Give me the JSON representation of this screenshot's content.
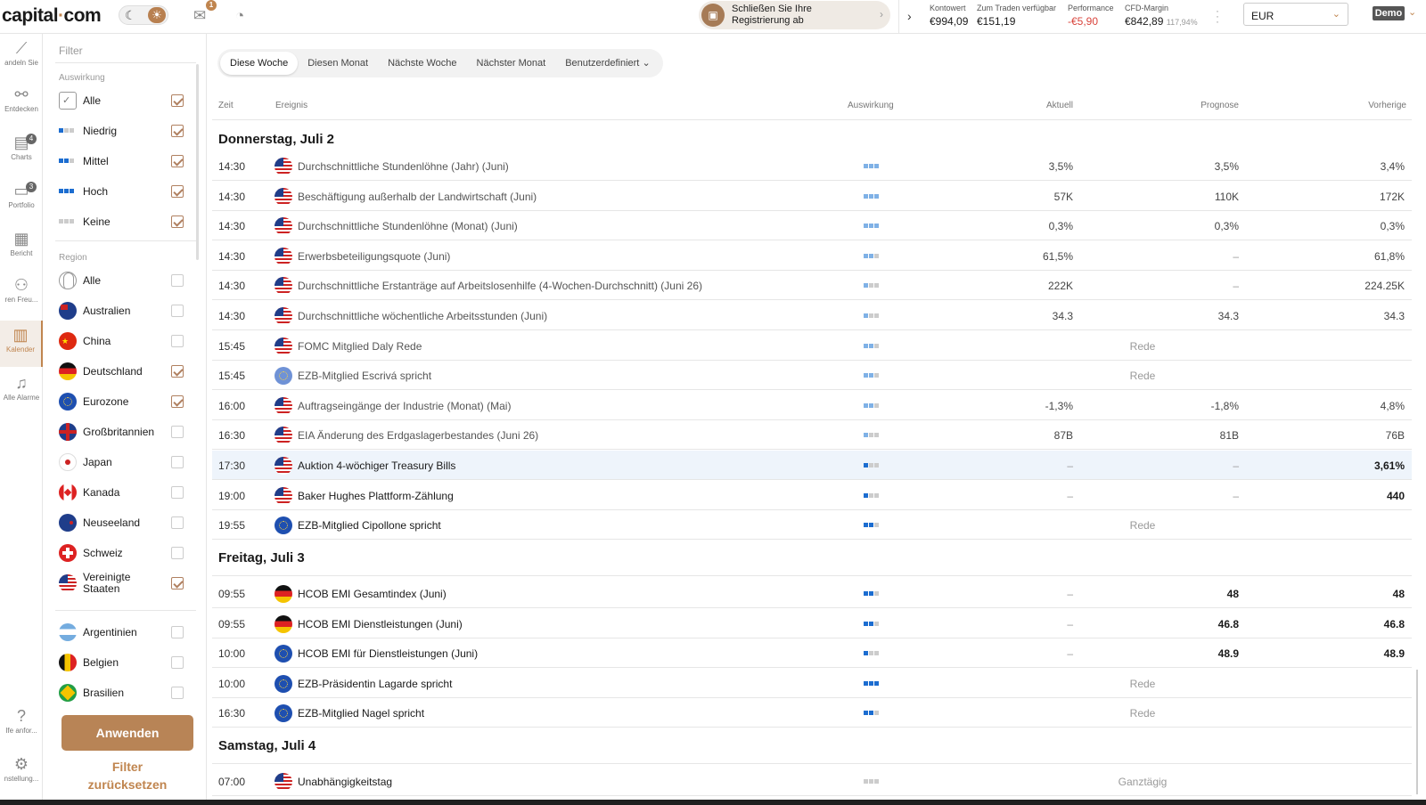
{
  "header": {
    "logo_text": "capital",
    "logo_dot": "·",
    "logo_suffix": "com",
    "mail_badge": "1",
    "promo_line1": "Schließen Sie Ihre",
    "promo_line2": "Registrierung ab",
    "stats": [
      {
        "label": "Kontowert",
        "value": "€994,09"
      },
      {
        "label": "Zum Traden verfügbar",
        "value": "€151,19"
      },
      {
        "label": "Performance",
        "value": "-€5,90"
      },
      {
        "label": "CFD-Margin",
        "value": "€842,89",
        "sub": "117,94%"
      }
    ],
    "currency": "EUR",
    "account_mode": "Demo"
  },
  "rail": [
    {
      "label": "andeln Sie",
      "icon": "chart-line-icon"
    },
    {
      "label": "Entdecken",
      "icon": "network-icon"
    },
    {
      "label": "Charts",
      "icon": "charts-icon",
      "badge": "4"
    },
    {
      "label": "Portfolio",
      "icon": "briefcase-icon",
      "badge": "3"
    },
    {
      "label": "Bericht",
      "icon": "report-icon"
    },
    {
      "label": "ren Freu...",
      "icon": "add-friend-icon"
    },
    {
      "label": "Kalender",
      "icon": "calendar-icon",
      "active": true
    },
    {
      "label": "Alle Alarme",
      "icon": "bell-icon"
    },
    {
      "label": "Ife anfor...",
      "icon": "help-icon"
    },
    {
      "label": "nstellung...",
      "icon": "gear-icon"
    }
  ],
  "filter": {
    "title": "Filter",
    "impact_title": "Auswirkung",
    "impact": [
      {
        "label": "Alle",
        "checked": true
      },
      {
        "label": "Niedrig",
        "checked": true
      },
      {
        "label": "Mittel",
        "checked": true
      },
      {
        "label": "Hoch",
        "checked": true
      },
      {
        "label": "Keine",
        "checked": true
      }
    ],
    "region_title": "Region",
    "regions": [
      {
        "label": "Alle",
        "checked": false,
        "flag": "globe"
      },
      {
        "label": "Australien",
        "checked": false,
        "flag": "au"
      },
      {
        "label": "China",
        "checked": false,
        "flag": "cn"
      },
      {
        "label": "Deutschland",
        "checked": true,
        "flag": "de"
      },
      {
        "label": "Eurozone",
        "checked": true,
        "flag": "eu"
      },
      {
        "label": "Großbritannien",
        "checked": false,
        "flag": "gb"
      },
      {
        "label": "Japan",
        "checked": false,
        "flag": "jp"
      },
      {
        "label": "Kanada",
        "checked": false,
        "flag": "ca"
      },
      {
        "label": "Neuseeland",
        "checked": false,
        "flag": "nz"
      },
      {
        "label": "Schweiz",
        "checked": false,
        "flag": "ch"
      },
      {
        "label": "Vereinigte Staaten",
        "checked": true,
        "flag": "us"
      },
      {
        "label": "Argentinien",
        "checked": false,
        "flag": "ar"
      },
      {
        "label": "Belgien",
        "checked": false,
        "flag": "be"
      },
      {
        "label": "Brasilien",
        "checked": false,
        "flag": "br"
      }
    ],
    "apply_label": "Anwenden",
    "reset_label": "Filter zurücksetzen"
  },
  "tabs": [
    {
      "label": "Diese Woche",
      "active": true
    },
    {
      "label": "Diesen Monat"
    },
    {
      "label": "Nächste Woche"
    },
    {
      "label": "Nächster Monat"
    },
    {
      "label": "Benutzerdefiniert"
    }
  ],
  "columns": {
    "time": "Zeit",
    "event": "Ereignis",
    "impact": "Auswirkung",
    "actual": "Aktuell",
    "forecast": "Prognose",
    "previous": "Vorherige"
  },
  "days": [
    {
      "title": "Donnerstag, Juli 2",
      "rows": [
        {
          "time": "14:30",
          "flag": "us",
          "event": "Durchschnittliche Stundenlöhne (Jahr) (Juni)",
          "impact": 3,
          "actual": "3,5%",
          "forecast": "3,5%",
          "previous": "3,4%",
          "past": true
        },
        {
          "time": "14:30",
          "flag": "us",
          "event": "Beschäftigung außerhalb der Landwirtschaft (Juni)",
          "impact": 3,
          "actual": "57K",
          "forecast": "110K",
          "previous": "172K",
          "past": true
        },
        {
          "time": "14:30",
          "flag": "us",
          "event": "Durchschnittliche Stundenlöhne (Monat) (Juni)",
          "impact": 3,
          "actual": "0,3%",
          "forecast": "0,3%",
          "previous": "0,3%",
          "past": true
        },
        {
          "time": "14:30",
          "flag": "us",
          "event": "Erwerbsbeteiligungsquote (Juni)",
          "impact": 2,
          "actual": "61,5%",
          "forecast": "–",
          "previous": "61,8%",
          "past": true
        },
        {
          "time": "14:30",
          "flag": "us",
          "event": "Durchschnittliche Erstanträge auf Arbeitslosenhilfe (4-Wochen-Durchschnitt) (Juni 26)",
          "impact": 1,
          "actual": "222K",
          "forecast": "–",
          "previous": "224.25K",
          "past": true
        },
        {
          "time": "14:30",
          "flag": "us",
          "event": "Durchschnittliche wöchentliche Arbeitsstunden (Juni)",
          "impact": 1,
          "actual": "34.3",
          "forecast": "34.3",
          "previous": "34.3",
          "past": true
        },
        {
          "time": "15:45",
          "flag": "us",
          "event": "FOMC Mitglied Daly Rede",
          "impact": 2,
          "speech": "Rede",
          "past": true
        },
        {
          "time": "15:45",
          "flag": "eu",
          "event": "EZB-Mitglied Escrivá spricht",
          "impact": 2,
          "speech": "Rede",
          "past": true
        },
        {
          "time": "16:00",
          "flag": "us",
          "event": "Auftragseingänge der Industrie (Monat) (Mai)",
          "impact": 2,
          "actual": "-1,3%",
          "forecast": "-1,8%",
          "previous": "4,8%",
          "past": true
        },
        {
          "time": "16:30",
          "flag": "us",
          "event": "EIA Änderung des Erdgaslagerbestandes (Juni 26)",
          "impact": 1,
          "actual": "87B",
          "forecast": "81B",
          "previous": "76B",
          "past": true
        },
        {
          "time": "17:30",
          "flag": "us",
          "event": "Auktion 4-wöchiger Treasury Bills",
          "impact": 1,
          "actual": "–",
          "forecast": "–",
          "previous": "3,61%",
          "highlight": true
        },
        {
          "time": "19:00",
          "flag": "us",
          "event": "Baker Hughes Plattform-Zählung",
          "impact": 1,
          "actual": "–",
          "forecast": "–",
          "previous": "440"
        },
        {
          "time": "19:55",
          "flag": "eu",
          "event": "EZB-Mitglied Cipollone spricht",
          "impact": 2,
          "speech": "Rede"
        }
      ]
    },
    {
      "title": "Freitag, Juli 3",
      "rows": [
        {
          "time": "09:55",
          "flag": "de",
          "event": "HCOB EMI Gesamtindex (Juni)",
          "impact": 2,
          "actual": "–",
          "forecast": "48",
          "previous": "48"
        },
        {
          "time": "09:55",
          "flag": "de",
          "event": "HCOB EMI Dienstleistungen (Juni)",
          "impact": 2,
          "actual": "–",
          "forecast": "46.8",
          "previous": "46.8"
        },
        {
          "time": "10:00",
          "flag": "eu",
          "event": "HCOB EMI für Dienstleistungen (Juni)",
          "impact": 1,
          "actual": "–",
          "forecast": "48.9",
          "previous": "48.9"
        },
        {
          "time": "10:00",
          "flag": "eu",
          "event": "EZB-Präsidentin Lagarde spricht",
          "impact": 3,
          "speech": "Rede"
        },
        {
          "time": "16:30",
          "flag": "eu",
          "event": "EZB-Mitglied Nagel spricht",
          "impact": 2,
          "speech": "Rede"
        }
      ]
    },
    {
      "title": "Samstag, Juli 4",
      "rows": [
        {
          "time": "07:00",
          "flag": "us",
          "event": "Unabhängigkeitstag",
          "impact": 0,
          "speech": "Ganztägig"
        }
      ]
    }
  ]
}
